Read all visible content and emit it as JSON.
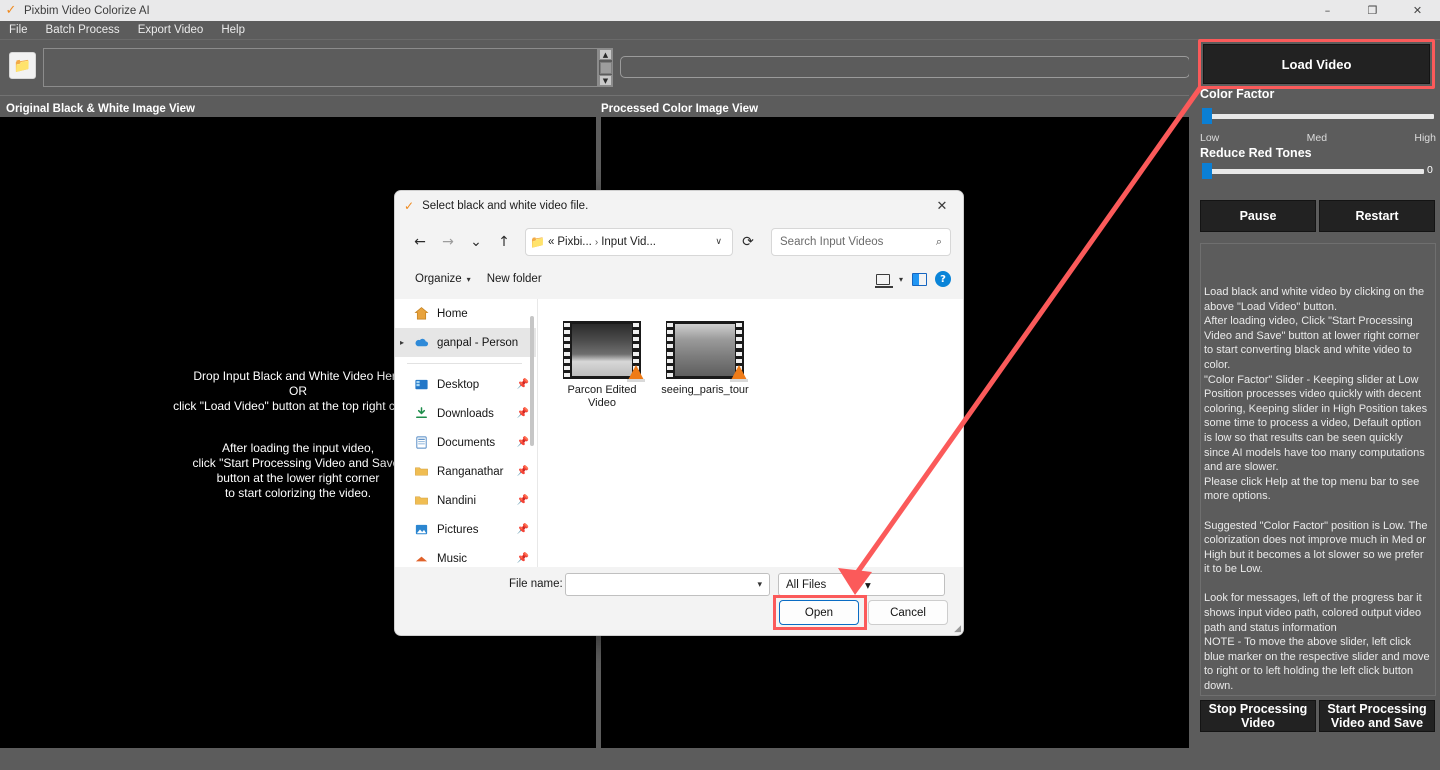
{
  "window": {
    "title": "Pixbim Video Colorize AI",
    "logo": "app-logo-icon",
    "minimize": "–",
    "maximize": "❐",
    "close": "✕"
  },
  "menubar": {
    "items": [
      {
        "label": "File"
      },
      {
        "label": "Batch Process"
      },
      {
        "label": "Export Video"
      },
      {
        "label": "Help"
      }
    ]
  },
  "toolbar": {
    "folder_icon": "📁",
    "scroll_up": "▲",
    "scroll_down": "▼"
  },
  "views": {
    "left_label": "Original Black & White Image View",
    "right_label": "Processed Color Image View",
    "drop_line1": "Drop Input Black and White Video Here",
    "drop_line2": "OR",
    "drop_line3": "click \"Load Video\" button at the top right corner",
    "hint_line1": "After loading the input video,",
    "hint_line2": "click \"Start Processing Video and Save\"",
    "hint_line3": "button at the lower right corner",
    "hint_line4": "to start colorizing the video."
  },
  "controls": {
    "load_video": "Load Video",
    "color_factor_label": "Color Factor",
    "color_factor_ticks": [
      "Low",
      "Med",
      "High"
    ],
    "color_factor_value": 0,
    "reduce_red_label": "Reduce Red Tones",
    "reduce_red_value": "0",
    "pause": "Pause",
    "restart": "Restart",
    "stop_processing": "Stop Processing\nVideo",
    "start_processing": "Start Processing\nVideo and Save",
    "info_text": "Load black and white video by clicking on the above \"Load Video\" button.\nAfter loading video, Click \"Start Processing Video and Save\" button at lower right corner to start converting black and white video to color.\n\"Color Factor\" Slider - Keeping slider at Low Position processes video quickly with decent coloring, Keeping slider in High Position takes some time to process a video, Default option is low so that results can be seen quickly since AI models have too many computations and are slower.\nPlease click Help at the top menu bar to see more options.\n\nSuggested \"Color Factor\" position is Low. The colorization does not improve much in Med or High but it becomes a lot slower so we prefer it to be Low.\n\nLook for messages, left of the progress bar it shows input video path, colored output video path and status information\nNOTE - To move the above slider, left click blue marker on the respective slider and move to right or to left holding the left click button down."
  },
  "dialog": {
    "title": "Select black and white video file.",
    "close_icon": "✕",
    "nav": {
      "back": "←",
      "forward": "→",
      "recent": "⌄",
      "up": "↑",
      "refresh": "⟳"
    },
    "address": {
      "folder_icon": "📁",
      "prefix": "«",
      "segment1": "Pixbi...",
      "separator": "›",
      "segment2": "Input Vid...",
      "chevron": "∨"
    },
    "search": {
      "placeholder": "Search Input Videos",
      "value": "",
      "icon": "⌕"
    },
    "commands": {
      "organize": "Organize",
      "organize_caret": "▾",
      "new_folder": "New folder",
      "layout_caret": "▾",
      "help_glyph": "?"
    },
    "sidebar": {
      "items": [
        {
          "label": "Home",
          "icon": "home-icon",
          "pinned": false,
          "selected": false,
          "expander": false
        },
        {
          "label": "ganpal - Person",
          "icon": "cloud-icon",
          "pinned": false,
          "selected": true,
          "expander": true
        },
        {
          "label": "Desktop",
          "icon": "desktop-icon",
          "pinned": true,
          "selected": false,
          "expander": false
        },
        {
          "label": "Downloads",
          "icon": "download-icon",
          "pinned": true,
          "selected": false,
          "expander": false
        },
        {
          "label": "Documents",
          "icon": "documents-icon",
          "pinned": true,
          "selected": false,
          "expander": false
        },
        {
          "label": "Ranganathar",
          "icon": "folder-icon",
          "pinned": true,
          "selected": false,
          "expander": false
        },
        {
          "label": "Nandini",
          "icon": "folder-icon",
          "pinned": true,
          "selected": false,
          "expander": false
        },
        {
          "label": "Pictures",
          "icon": "pictures-icon",
          "pinned": true,
          "selected": false,
          "expander": false
        },
        {
          "label": "Music",
          "icon": "music-icon",
          "pinned": true,
          "selected": false,
          "expander": false
        }
      ]
    },
    "files": [
      {
        "name": "Parcon Edited Video",
        "type": "video-file"
      },
      {
        "name": "seeing_paris_tour",
        "type": "video-file"
      }
    ],
    "footer": {
      "file_name_label": "File name:",
      "file_name_value": "",
      "file_type_value": "All Files",
      "open": "Open",
      "cancel": "Cancel"
    }
  },
  "annotation": {
    "accent_color": "#fb5a5a",
    "highlights": [
      "load-video-button",
      "open-button"
    ],
    "arrow": "load-video-to-open"
  }
}
